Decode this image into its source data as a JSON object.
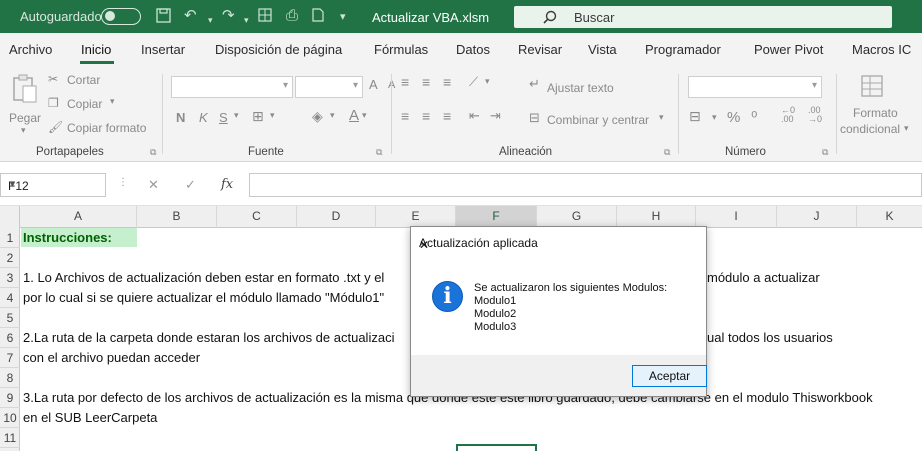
{
  "titlebar": {
    "autosave_label": "Autoguardado",
    "filename": "Actualizar VBA.xlsm",
    "search_placeholder": "Buscar"
  },
  "tabs": [
    {
      "label": "Archivo"
    },
    {
      "label": "Inicio"
    },
    {
      "label": "Insertar"
    },
    {
      "label": "Disposición de página"
    },
    {
      "label": "Fórmulas"
    },
    {
      "label": "Datos"
    },
    {
      "label": "Revisar"
    },
    {
      "label": "Vista"
    },
    {
      "label": "Programador"
    },
    {
      "label": "Power Pivot"
    },
    {
      "label": "Macros IC"
    }
  ],
  "ribbon": {
    "clipboard": {
      "paste": "Pegar",
      "cut": "Cortar",
      "copy": "Copiar",
      "format_painter": "Copiar formato",
      "group": "Portapapeles"
    },
    "font": {
      "bold": "N",
      "italic": "K",
      "underline": "S",
      "group": "Fuente"
    },
    "alignment": {
      "wrap_text": "Ajustar texto",
      "merge_center": "Combinar y centrar",
      "group": "Alineación"
    },
    "number": {
      "percent": "%",
      "group": "Número"
    },
    "styles": {
      "conditional_format_line1": "Formato",
      "conditional_format_line2": "condicional"
    }
  },
  "formula_bar": {
    "name_box": "F12",
    "fx": "fx",
    "formula": ""
  },
  "columns": [
    "A",
    "B",
    "C",
    "D",
    "E",
    "F",
    "G",
    "H",
    "I",
    "J",
    "K"
  ],
  "selected_column": "F",
  "rows": [
    "1",
    "2",
    "3",
    "4",
    "5",
    "6",
    "7",
    "8",
    "9",
    "10",
    "11"
  ],
  "cells": {
    "a1": "Instrucciones:",
    "a3_left": "1. Lo Archivos de actualización deben estar en formato .txt y el",
    "a3_right": "módulo a actualizar",
    "a4": "por lo cual si se quiere actualizar el módulo llamado \"Módulo1\"",
    "a6_left": "2.La ruta de la carpeta donde estaran los archivos de actualizaci",
    "a6_right": "ual todos los usuarios",
    "a7": "con el archivo puedan acceder",
    "a9": "3.La ruta por defecto de los archivos de actualización es la misma que donde este este libro guardado, debe cambiarse en el modulo Thisworkbook",
    "a10": "en el SUB LeerCarpeta"
  },
  "dialog": {
    "title": "Actualización aplicada",
    "message_line1": "Se actualizaron los siguientes Modulos:",
    "message_line2": "Modulo1",
    "message_line3": "Modulo2",
    "message_line4": "Modulo3",
    "ok_label": "Aceptar"
  },
  "colors": {
    "excel_green": "#217346",
    "header_cell_fill": "#c6efce",
    "header_cell_text": "#006100",
    "info_blue": "#1a73d9"
  }
}
